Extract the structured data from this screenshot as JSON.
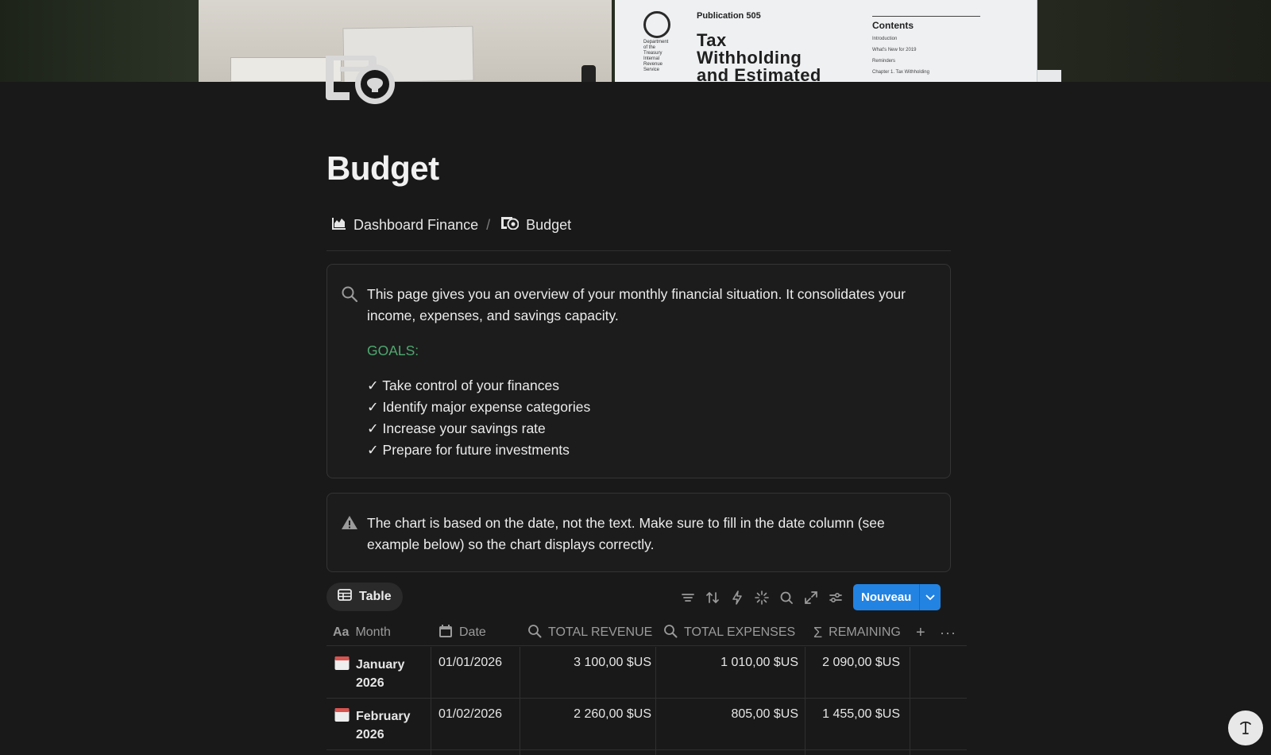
{
  "cover": {
    "publication": "Publication 505",
    "heading": "Tax Withholding and Estimated",
    "contents": "Contents",
    "toc": [
      "Introduction",
      "What's New for 2019",
      "Reminders",
      "Chapter 1. Tax Withholding"
    ],
    "dept": "Department of the Treasury Internal Revenue Service"
  },
  "page": {
    "title": "Budget",
    "breadcrumb": [
      {
        "label": "Dashboard Finance",
        "icon": "chart-icon"
      },
      {
        "label": "Budget",
        "icon": "money-icon"
      }
    ],
    "breadcrumb_sep": "/"
  },
  "callout_info": {
    "text": "This page gives you an overview of your monthly financial situation. It consolidates your income, expenses, and savings capacity.",
    "goals_title": "GOALS:",
    "goals": [
      "✓ Take control of your finances",
      "✓ Identify major expense categories",
      "✓ Increase your savings rate",
      "✓ Prepare for future investments"
    ],
    "accent_color": "#4fa870"
  },
  "callout_warning": {
    "text": "The chart is based on the date, not the text. Make sure to fill in the date column (see example below) so the chart displays correctly."
  },
  "table_view": {
    "view_label": "Table",
    "new_button": "Nouveau",
    "new_button_color": "#2383e2",
    "columns": [
      {
        "label": "Month",
        "icon": "text-type-icon"
      },
      {
        "label": "Date",
        "icon": "calendar-icon"
      },
      {
        "label": "TOTAL REVENUE",
        "icon": "search-icon"
      },
      {
        "label": "TOTAL EXPENSES",
        "icon": "search-icon"
      },
      {
        "label": "REMAINING",
        "icon": "sigma-icon"
      }
    ],
    "rows": [
      {
        "month_line1": "January",
        "month_line2": "2026",
        "date": "01/01/2026",
        "revenue": "3 100,00 $US",
        "expenses": "1 010,00 $US",
        "remaining": "2 090,00 $US"
      },
      {
        "month_line1": "February",
        "month_line2": "2026",
        "date": "01/02/2026",
        "revenue": "2 260,00 $US",
        "expenses": "805,00 $US",
        "remaining": "1 455,00 $US"
      }
    ]
  },
  "help_button": "?"
}
